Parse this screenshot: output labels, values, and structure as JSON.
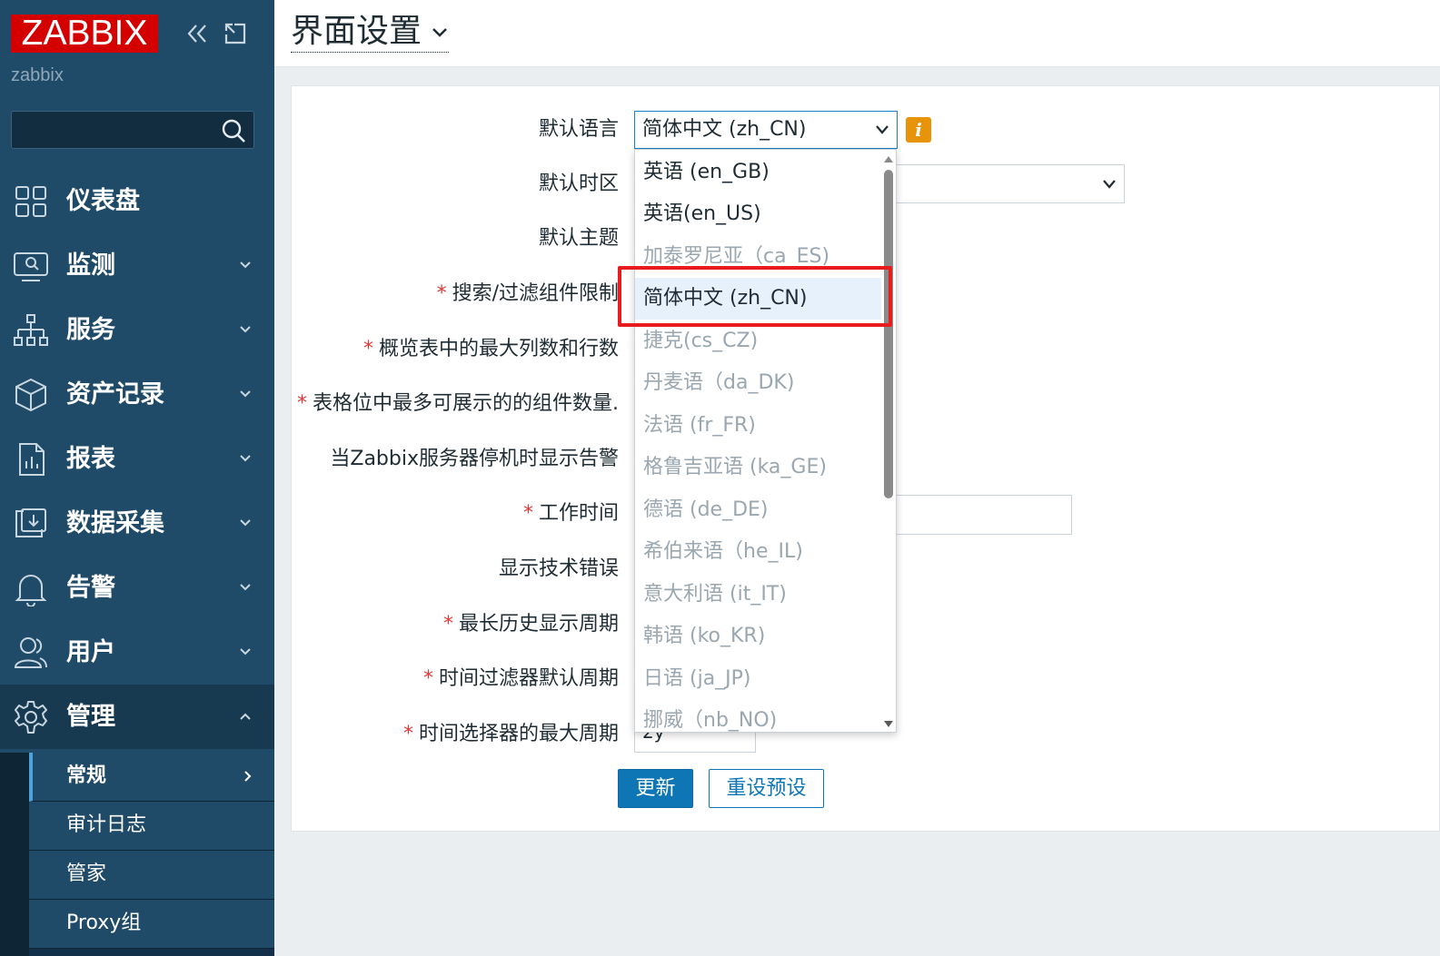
{
  "app": {
    "logo_text": "ZABBIX",
    "server_name": "zabbix",
    "search_placeholder": "",
    "brand_color": "#d40000",
    "sidebar_color": "#1f4b68"
  },
  "sidebar": {
    "items": [
      {
        "label": "仪表盘",
        "icon": "dashboard-icon",
        "expandable": false
      },
      {
        "label": "监测",
        "icon": "monitoring-icon",
        "expandable": true
      },
      {
        "label": "服务",
        "icon": "services-icon",
        "expandable": true
      },
      {
        "label": "资产记录",
        "icon": "inventory-icon",
        "expandable": true
      },
      {
        "label": "报表",
        "icon": "reports-icon",
        "expandable": true
      },
      {
        "label": "数据采集",
        "icon": "data-collection-icon",
        "expandable": true
      },
      {
        "label": "告警",
        "icon": "alerts-icon",
        "expandable": true
      },
      {
        "label": "用户",
        "icon": "users-icon",
        "expandable": true
      },
      {
        "label": "管理",
        "icon": "gear-icon",
        "expandable": true,
        "expanded": true
      }
    ],
    "submenu": [
      {
        "label": "常规",
        "selected": true
      },
      {
        "label": "审计日志"
      },
      {
        "label": "管家"
      },
      {
        "label": "Proxy组"
      }
    ]
  },
  "header": {
    "title": "界面设置"
  },
  "form": {
    "labels": {
      "default_language": "默认语言",
      "default_timezone": "默认时区",
      "default_theme": "默认主题",
      "search_limit": "搜索/过滤组件限制",
      "max_columns_rows": "概览表中的最大列数和行数",
      "max_widgets": "表格位中最多可展示的的组件数量.",
      "server_down_alert": "当Zabbix服务器停机时显示告警",
      "work_period": "工作时间",
      "show_tech_errors": "显示技术错误",
      "max_history_period": "最长历史显示周期",
      "time_filter_default": "时间过滤器默认周期",
      "max_period": "时间选择器的最大周期"
    },
    "required_marker": "*",
    "language_value": "简体中文 (zh_CN)",
    "info_icon_text": "i",
    "max_period_value": "2y",
    "buttons": {
      "update": "更新",
      "reset": "重设预设"
    }
  },
  "language_dropdown": {
    "options": [
      {
        "label": "英语 (en_GB)",
        "enabled": true
      },
      {
        "label": "英语(en_US)",
        "enabled": true
      },
      {
        "label": "加泰罗尼亚（ca_ES)",
        "enabled": false
      },
      {
        "label": "简体中文 (zh_CN)",
        "enabled": true,
        "selected": true
      },
      {
        "label": "捷克(cs_CZ)",
        "enabled": false
      },
      {
        "label": "丹麦语（da_DK)",
        "enabled": false
      },
      {
        "label": "法语 (fr_FR)",
        "enabled": false
      },
      {
        "label": "格鲁吉亚语 (ka_GE)",
        "enabled": false
      },
      {
        "label": "德语 (de_DE)",
        "enabled": false
      },
      {
        "label": "希伯来语（he_IL)",
        "enabled": false
      },
      {
        "label": "意大利语 (it_IT)",
        "enabled": false
      },
      {
        "label": "韩语 (ko_KR)",
        "enabled": false
      },
      {
        "label": "日语 (ja_JP)",
        "enabled": false
      },
      {
        "label": "挪威（nb_NO)",
        "enabled": false
      }
    ]
  }
}
